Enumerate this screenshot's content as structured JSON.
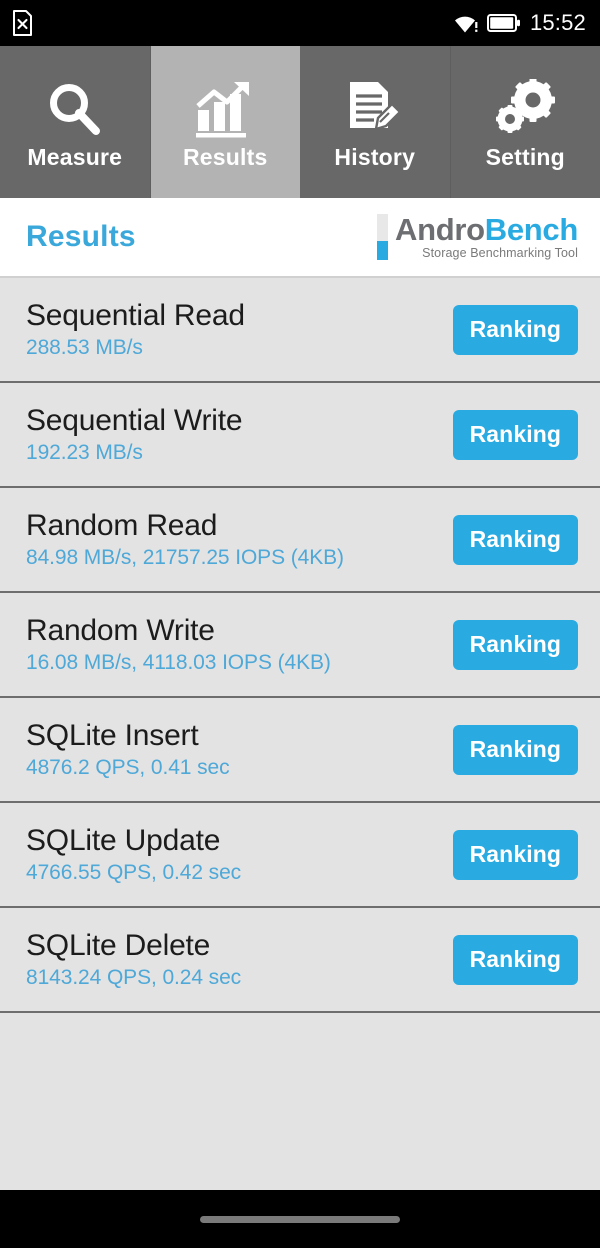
{
  "status_bar": {
    "sim_icon": "sim-card-missing-icon",
    "wifi_icon": "wifi-no-internet-icon",
    "battery_icon": "battery-icon",
    "time": "15:52"
  },
  "tabs": [
    {
      "label": "Measure",
      "icon": "magnifier-icon",
      "active": false
    },
    {
      "label": "Results",
      "icon": "bar-chart-icon",
      "active": true
    },
    {
      "label": "History",
      "icon": "document-pencil-icon",
      "active": false
    },
    {
      "label": "Setting",
      "icon": "gears-icon",
      "active": false
    }
  ],
  "header": {
    "title": "Results",
    "brand_primary": "Andro",
    "brand_secondary": "Bench",
    "tagline": "Storage Benchmarking Tool"
  },
  "results": [
    {
      "name": "Sequential Read",
      "value": "288.53 MB/s",
      "button": "Ranking"
    },
    {
      "name": "Sequential Write",
      "value": "192.23 MB/s",
      "button": "Ranking"
    },
    {
      "name": "Random Read",
      "value": "84.98 MB/s, 21757.25 IOPS (4KB)",
      "button": "Ranking"
    },
    {
      "name": "Random Write",
      "value": "16.08 MB/s, 4118.03 IOPS (4KB)",
      "button": "Ranking"
    },
    {
      "name": "SQLite Insert",
      "value": "4876.2 QPS, 0.41 sec",
      "button": "Ranking"
    },
    {
      "name": "SQLite Update",
      "value": "4766.55 QPS, 0.42 sec",
      "button": "Ranking"
    },
    {
      "name": "SQLite Delete",
      "value": "8143.24 QPS, 0.24 sec",
      "button": "Ranking"
    }
  ],
  "nav_bar": {
    "handle": "home-gesture-handle"
  },
  "colors": {
    "accent_blue": "#29abe2",
    "value_blue": "#4ea8d8",
    "tab_inactive": "#686868",
    "tab_active": "#b3b3b3",
    "list_bg": "#e3e3e3",
    "brand_gray": "#6d6e71"
  }
}
